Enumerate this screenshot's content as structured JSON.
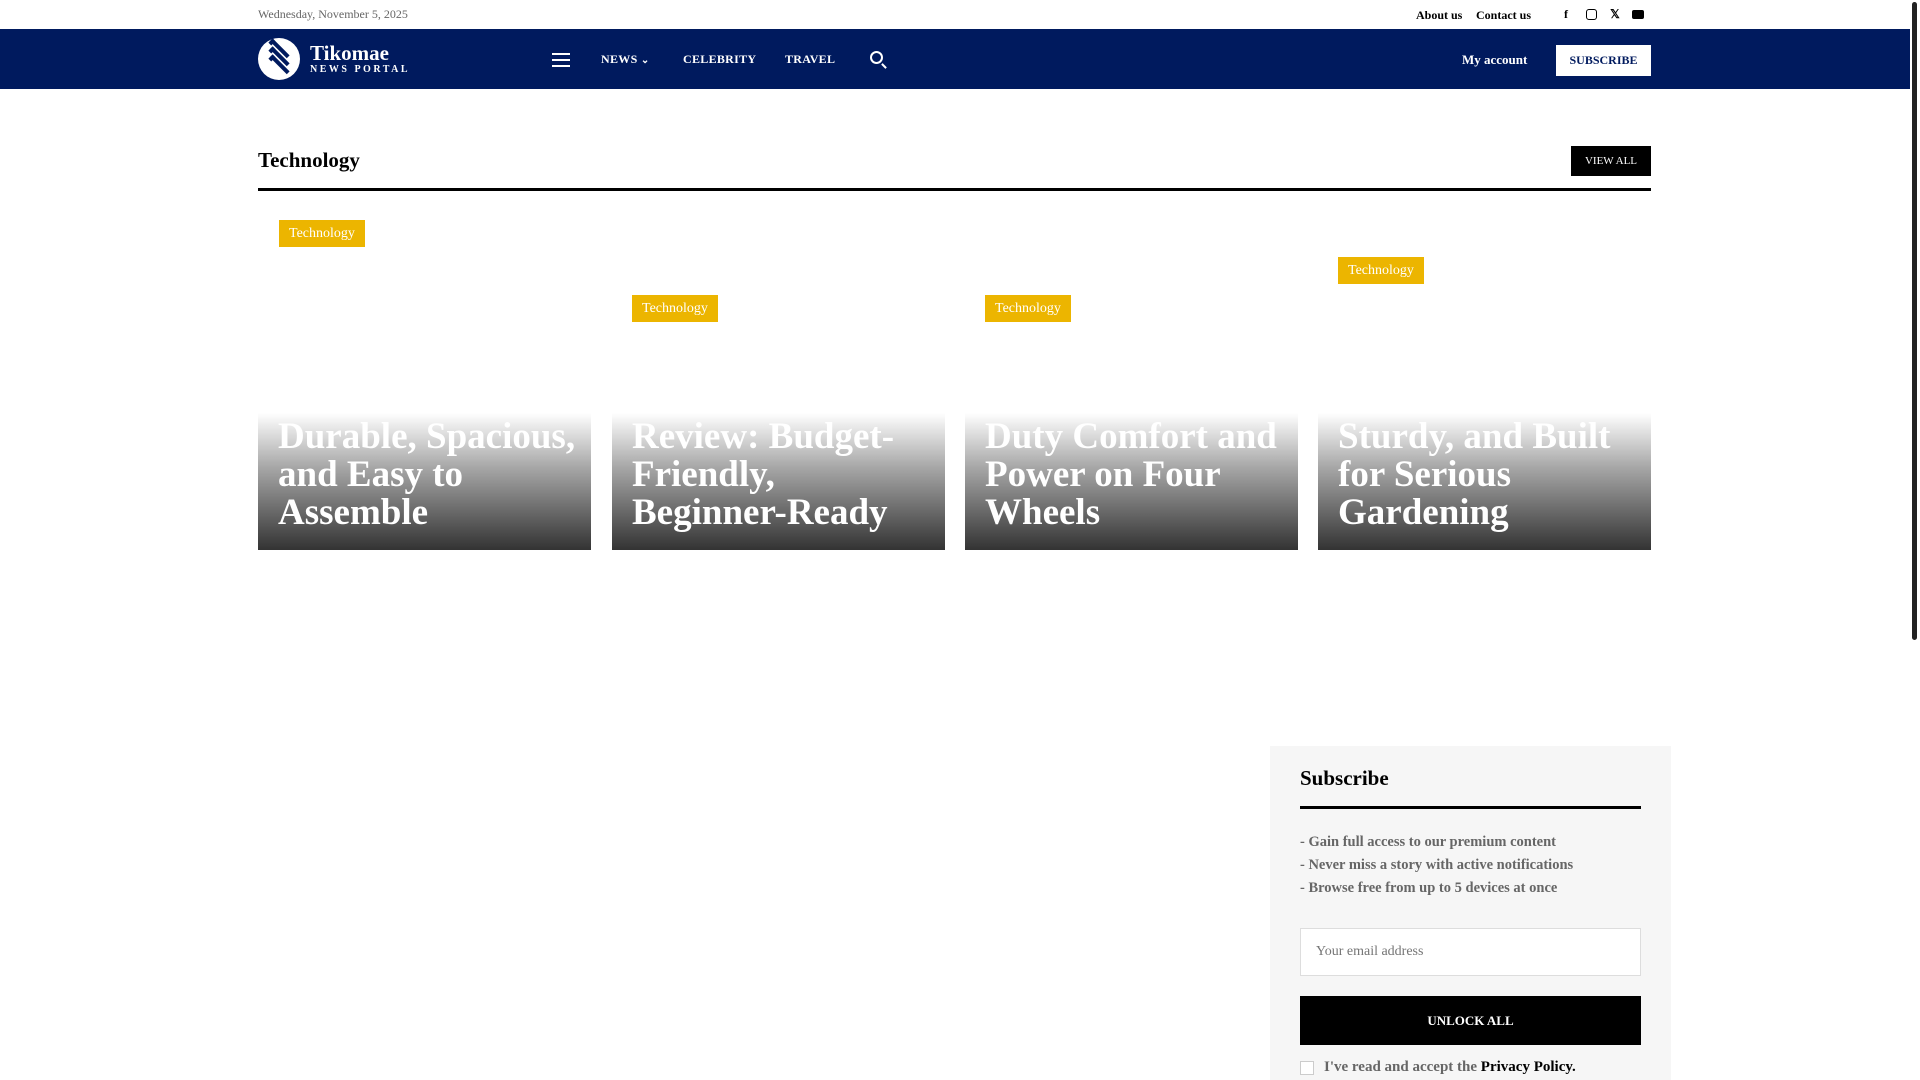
{
  "topbar": {
    "date": "Wednesday, November 5, 2025",
    "links": [
      "About us",
      "Contact us"
    ],
    "social": [
      "facebook-icon",
      "instagram-icon",
      "x-icon",
      "youtube-icon"
    ]
  },
  "header": {
    "logo_name": "Tikomae",
    "logo_sub": "NEWS PORTAL",
    "nav": [
      "NEWS",
      "CELEBRITY",
      "TRAVEL"
    ],
    "news_chevron": "⌄",
    "my_account": "My account",
    "subscribe": "SUBSCRIBE",
    "brand_color": "#001a5e"
  },
  "section": {
    "title": "Technology",
    "view_all": "VIEW ALL"
  },
  "cards": [
    {
      "tag": "Technology",
      "title_visible": "Durable, Spacious, and Easy to Assemble"
    },
    {
      "tag": "Technology",
      "title_visible": "Review: Budget-Friendly, Beginner-Ready"
    },
    {
      "tag": "Technology",
      "title_visible": "Duty Comfort and Power on Four Wheels"
    },
    {
      "tag": "Technology",
      "title_visible": "Sturdy, and Built for Serious Gardening"
    }
  ],
  "subscribe_box": {
    "title": "Subscribe",
    "bullets": [
      "- Gain full access to our premium content",
      "- Never miss a story with active notifications",
      "- Browse free from up to 5 devices at once"
    ],
    "email_placeholder": "Your email address",
    "button": "UNLOCK ALL",
    "accept_text": "I've read and accept the ",
    "policy_link": "Privacy Policy",
    "period": "."
  },
  "tag_color": "#ecb500"
}
